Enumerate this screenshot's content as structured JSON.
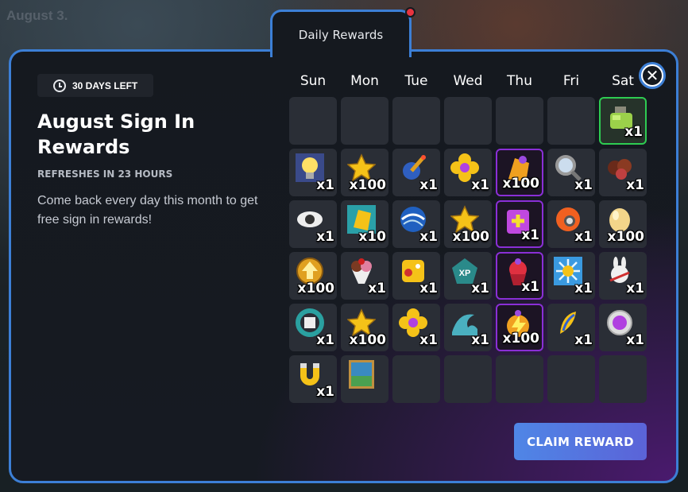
{
  "background": {
    "text": "August 3."
  },
  "tab": {
    "label": "Daily Rewards"
  },
  "header": {
    "days_left": "30 DAYS LEFT",
    "title": "August Sign In Rewards",
    "refresh": "REFRESHES IN 23 HOURS",
    "description": "Come back every day this month to get free sign in rewards!"
  },
  "calendar": {
    "weekdays": [
      "Sun",
      "Mon",
      "Tue",
      "Wed",
      "Thu",
      "Fri",
      "Sat"
    ],
    "days": [
      null,
      null,
      null,
      null,
      null,
      null,
      {
        "icon": "potion-icon",
        "qty": "x1",
        "state": "today"
      },
      {
        "icon": "lightbulb-icon",
        "qty": "x1"
      },
      {
        "icon": "star-icon",
        "qty": "x100"
      },
      {
        "icon": "bomb-icon",
        "qty": "x1"
      },
      {
        "icon": "flower-icon",
        "qty": "x1"
      },
      {
        "icon": "paper-boost-icon",
        "qty": "x100",
        "state": "special"
      },
      {
        "icon": "magnifier-icon",
        "qty": "x1"
      },
      {
        "icon": "chocolate-icon",
        "qty": "x1"
      },
      {
        "icon": "eye-icon",
        "qty": "x1"
      },
      {
        "icon": "gold-card-icon",
        "qty": "x10"
      },
      {
        "icon": "globe-icon",
        "qty": "x1"
      },
      {
        "icon": "star-icon",
        "qty": "x100"
      },
      {
        "icon": "plus-card-icon",
        "qty": "x1",
        "state": "special"
      },
      {
        "icon": "fireball-icon",
        "qty": "x1"
      },
      {
        "icon": "egg-icon",
        "qty": "x100"
      },
      {
        "icon": "coin-arrow-icon",
        "qty": "x100"
      },
      {
        "icon": "sundae-icon",
        "qty": "x1"
      },
      {
        "icon": "dice-icon",
        "qty": "x1"
      },
      {
        "icon": "xp-boost-icon",
        "qty": "x1"
      },
      {
        "icon": "cupcake-icon",
        "qty": "x1",
        "state": "special"
      },
      {
        "icon": "snowflake-clock-icon",
        "qty": "x1"
      },
      {
        "icon": "bunny-icon",
        "qty": "x1"
      },
      {
        "icon": "refresh-gift-icon",
        "qty": "x1"
      },
      {
        "icon": "star-icon",
        "qty": "x100"
      },
      {
        "icon": "flower-icon",
        "qty": "x1"
      },
      {
        "icon": "wave-icon",
        "qty": "x1"
      },
      {
        "icon": "lightning-boost-icon",
        "qty": "x100",
        "state": "special"
      },
      {
        "icon": "feather-icon",
        "qty": "x1"
      },
      {
        "icon": "purple-coin-icon",
        "qty": "x1"
      },
      {
        "icon": "magnet-icon",
        "qty": "x1"
      },
      {
        "icon": "painting-icon",
        "qty": ""
      },
      null,
      null,
      null,
      null,
      null
    ]
  },
  "actions": {
    "close": "✕",
    "claim": "CLAIM REWARD"
  },
  "colors": {
    "accent": "#3c7fd6",
    "special_border": "#8a2fd6",
    "today_border": "#2ecc52",
    "notify_dot": "#e8343f"
  }
}
